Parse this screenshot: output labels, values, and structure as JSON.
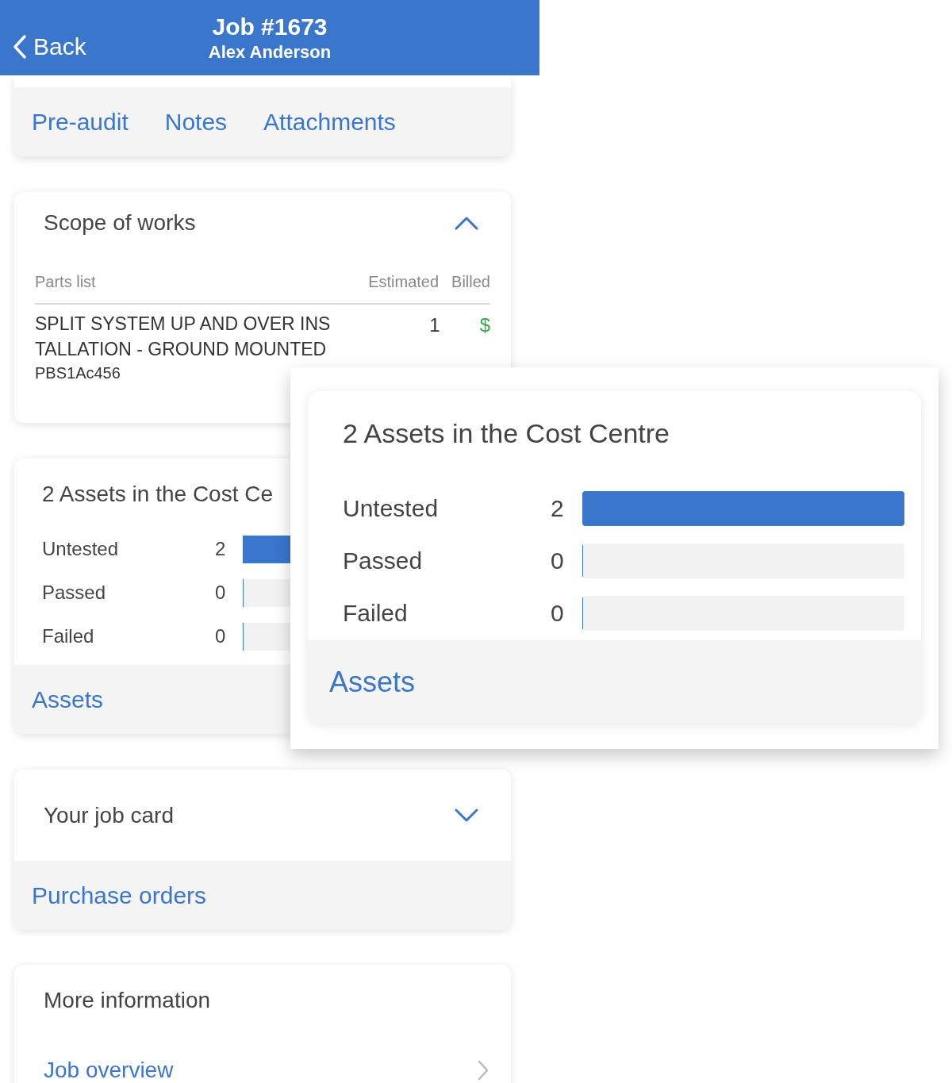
{
  "header": {
    "back": "Back",
    "title": "Job #1673",
    "subtitle": "Alex Anderson"
  },
  "tabs": [
    "Pre-audit",
    "Notes",
    "Attachments"
  ],
  "scope": {
    "title": "Scope of works",
    "expanded": true,
    "columns": [
      "Parts list",
      "Estimated",
      "Billed"
    ],
    "rows": [
      {
        "name_lines": [
          "SPLIT SYSTEM UP AND OVER INS",
          "TALLATION - GROUND MOUNTED"
        ],
        "code": "PBS1Ac456",
        "estimated": "1",
        "billed": "$"
      }
    ]
  },
  "assets": {
    "title": "2 Assets in the Cost Ce",
    "rows": [
      {
        "label": "Untested",
        "count": "2",
        "level": 1
      },
      {
        "label": "Passed",
        "count": "0",
        "level": 0
      },
      {
        "label": "Failed",
        "count": "0",
        "level": 0
      }
    ],
    "link": "Assets"
  },
  "callout": {
    "title": "2 Assets in the Cost Centre",
    "rows": [
      {
        "label": "Untested",
        "count": "2",
        "level": 1
      },
      {
        "label": "Passed",
        "count": "0",
        "level": 0
      },
      {
        "label": "Failed",
        "count": "0",
        "level": 0
      }
    ],
    "link": "Assets"
  },
  "job_card": {
    "title": "Your job card",
    "expanded": false,
    "link": "Purchase orders"
  },
  "more": {
    "title": "More information",
    "link": "Job overview"
  }
}
